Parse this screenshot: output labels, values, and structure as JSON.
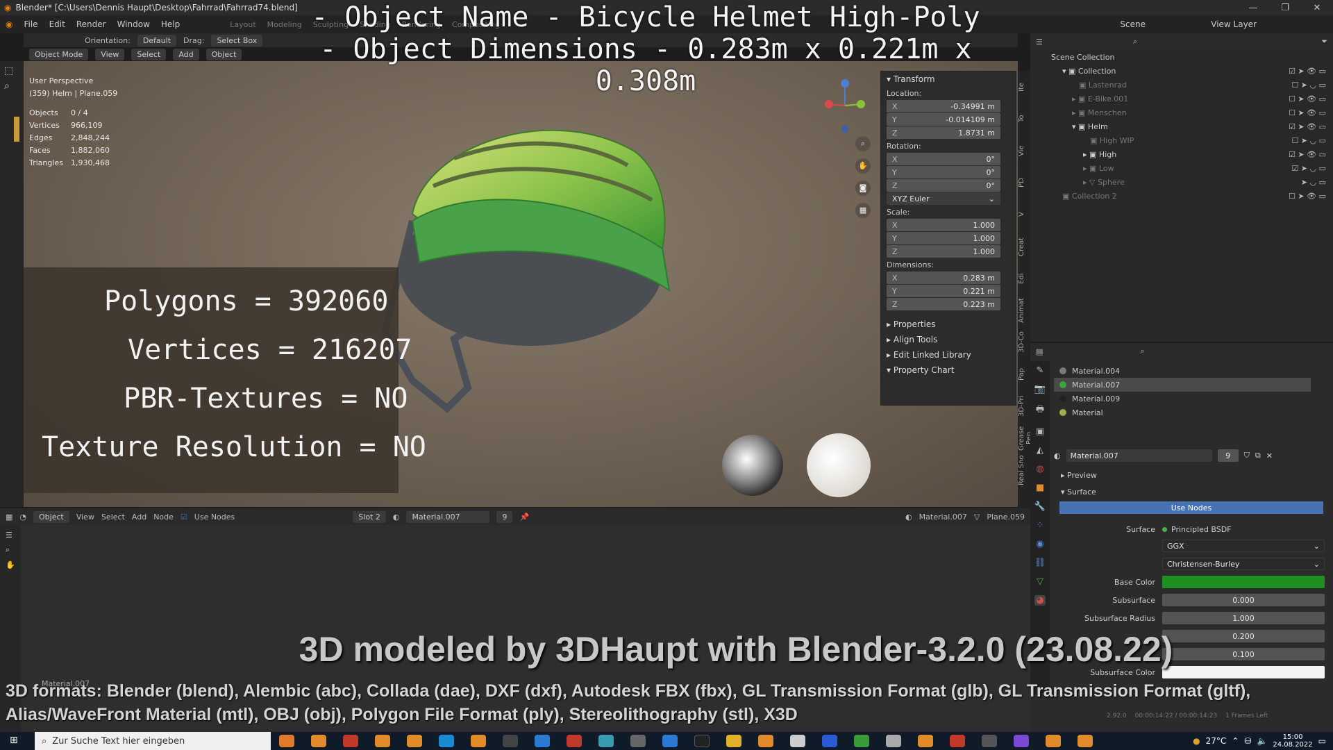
{
  "window": {
    "title": "Blender* [C:\\Users\\Dennis Haupt\\Desktop\\Fahrrad\\Fahrrad74.blend]"
  },
  "menubar": {
    "items": [
      "File",
      "Edit",
      "Render",
      "Window",
      "Help"
    ],
    "workspaces": [
      "Layout",
      "Modeling",
      "Sculpting",
      "Shading",
      "Rendering",
      "Compositing"
    ],
    "scene": "Scene",
    "view_layer": "View Layer"
  },
  "overlay_title": {
    "line1": "- Object Name - Bicycle Helmet High-Poly",
    "line2": "- Object Dimensions -  0.283m x 0.221m x 0.308m"
  },
  "viewport_header": {
    "orientation_label": "Orientation:",
    "orientation_value": "Default",
    "drag_label": "Drag:",
    "drag_value": "Select Box",
    "mode": "Object Mode",
    "menus": [
      "View",
      "Select",
      "Add",
      "Object"
    ]
  },
  "viewport_info": {
    "perspective": "User Perspective",
    "object": "(359) Helm | Plane.059",
    "stats": [
      {
        "k": "Objects",
        "v": "0 / 4"
      },
      {
        "k": "Vertices",
        "v": "966,109"
      },
      {
        "k": "Edges",
        "v": "2,848,244"
      },
      {
        "k": "Faces",
        "v": "1,882,060"
      },
      {
        "k": "Triangles",
        "v": "1,930,468"
      }
    ]
  },
  "overlay_stats": {
    "polygons": "Polygons = 392060",
    "vertices": "Vertices = 216207",
    "pbr": "PBR-Textures = NO",
    "resolution": "Texture Resolution = NO"
  },
  "transform_panel": {
    "title": "Transform",
    "location_label": "Location:",
    "location": [
      {
        "ax": "X",
        "v": "-0.34991 m"
      },
      {
        "ax": "Y",
        "v": "-0.014109 m"
      },
      {
        "ax": "Z",
        "v": "1.8731 m"
      }
    ],
    "rotation_label": "Rotation:",
    "rotation": [
      {
        "ax": "X",
        "v": "0°"
      },
      {
        "ax": "Y",
        "v": "0°"
      },
      {
        "ax": "Z",
        "v": "0°"
      }
    ],
    "rotation_mode": "XYZ Euler",
    "scale_label": "Scale:",
    "scale": [
      {
        "ax": "X",
        "v": "1.000"
      },
      {
        "ax": "Y",
        "v": "1.000"
      },
      {
        "ax": "Z",
        "v": "1.000"
      }
    ],
    "dimensions_label": "Dimensions:",
    "dimensions": [
      {
        "ax": "X",
        "v": "0.283 m"
      },
      {
        "ax": "Y",
        "v": "0.221 m"
      },
      {
        "ax": "Z",
        "v": "0.223 m"
      }
    ],
    "sections": [
      "Properties",
      "Align Tools",
      "Edit Linked Library",
      "Property Chart"
    ]
  },
  "npanel_tabs": [
    "Ite",
    "To",
    "Vie",
    "PD",
    "V",
    "Creat",
    "Edi",
    "Animat",
    "3D-Co",
    "Pap",
    "3D-Pri",
    "Grease Pen",
    "Real Sno"
  ],
  "outliner": {
    "root": "Scene Collection",
    "rows": [
      {
        "label": "Collection",
        "indent": 1,
        "dim": false
      },
      {
        "label": "Lastenrad",
        "indent": 2,
        "dim": true
      },
      {
        "label": "E-Bike.001",
        "indent": 2,
        "dim": true
      },
      {
        "label": "Menschen",
        "indent": 2,
        "dim": true
      },
      {
        "label": "Helm",
        "indent": 2,
        "dim": false
      },
      {
        "label": "High WIP",
        "indent": 3,
        "dim": true
      },
      {
        "label": "High",
        "indent": 3,
        "dim": false
      },
      {
        "label": "Low",
        "indent": 3,
        "dim": true
      },
      {
        "label": "Sphere",
        "indent": 3,
        "dim": true
      },
      {
        "label": "Collection 2",
        "indent": 1,
        "dim": true
      }
    ]
  },
  "materials": {
    "slots": [
      {
        "name": "Material.004",
        "color": "#7a7a7a",
        "selected": false
      },
      {
        "name": "Material.007",
        "color": "#3aa53a",
        "selected": true
      },
      {
        "name": "Material.009",
        "color": "#222222",
        "selected": false
      },
      {
        "name": "Material",
        "color": "#9ab04a",
        "selected": false
      }
    ],
    "active": "Material.007",
    "users": "9",
    "preview": "Preview",
    "surface": "Surface",
    "use_nodes": "Use Nodes",
    "surface_label": "Surface",
    "surface_value": "Principled BSDF",
    "distribution": "GGX",
    "subsurface_method": "Christensen-Burley",
    "base_color_label": "Base Color",
    "base_color": "#1f8f1f",
    "subsurface_label": "Subsurface",
    "subsurface_value": "0.000",
    "radius_label": "Subsurface Radius",
    "radius": [
      "1.000",
      "0.200",
      "0.100"
    ],
    "subsurface_color_label": "Subsurface Color"
  },
  "shader_header": {
    "editor": "Object",
    "menus": [
      "View",
      "Select",
      "Add",
      "Node"
    ],
    "use_nodes": "Use Nodes",
    "slot": "Slot 2",
    "material": "Material.007",
    "users": "9",
    "material_right": "Material.007",
    "object_right": "Plane.059"
  },
  "shader_node_label": "Material.007",
  "credit": "3D modeled by 3DHaupt with Blender-3.2.0 (23.08.22)",
  "formats": "3D formats: Blender (blend), Alembic (abc), Collada (dae), DXF (dxf), Autodesk FBX (fbx), GL Transmission Format (glb), GL Transmission Format (gltf), Alias/WaveFront Material (mtl), OBJ (obj), Polygon File Format (ply), Stereolithography (stl), X3D",
  "statusbar": {
    "version": "2.92.0",
    "time": "00:00:14:22 / 00:00:14:23",
    "frames": "1 Frames Left"
  },
  "taskbar": {
    "search_placeholder": "Zur Suche Text hier eingeben",
    "temperature": "27°C",
    "time": "15:00",
    "date": "24.08.2022"
  }
}
